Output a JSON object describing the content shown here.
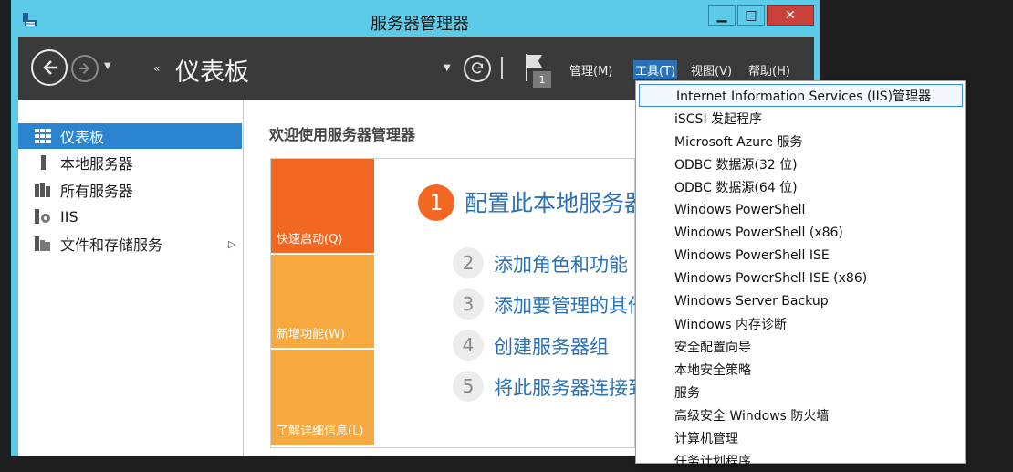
{
  "window": {
    "title": "服务器管理器",
    "minimize": "▁",
    "maximize": "□",
    "close": "✕"
  },
  "cmdbar": {
    "breadcrumb_arrows": "‹‹",
    "title": "仪表板",
    "flag_badge": "1",
    "menus": {
      "manage": "管理(M)",
      "tools": "工具(T)",
      "view": "视图(V)",
      "help": "帮助(H)"
    }
  },
  "sidebar": {
    "items": [
      {
        "label": "仪表板",
        "icon": "dashboard-grid-icon"
      },
      {
        "label": "本地服务器",
        "icon": "local-server-icon"
      },
      {
        "label": "所有服务器",
        "icon": "all-servers-icon"
      },
      {
        "label": "IIS",
        "icon": "iis-icon"
      },
      {
        "label": "文件和存储服务",
        "icon": "file-storage-icon"
      }
    ]
  },
  "main": {
    "welcome": "欢迎使用服务器管理器",
    "tiles": {
      "quick": "快速启动(Q)",
      "new": "新增功能(W)",
      "more": "了解详细信息(L)"
    },
    "steps": [
      {
        "num": "1",
        "text": "配置此本地服务器"
      },
      {
        "num": "2",
        "text": "添加角色和功能"
      },
      {
        "num": "3",
        "text": "添加要管理的其他服务器"
      },
      {
        "num": "4",
        "text": "创建服务器组"
      },
      {
        "num": "5",
        "text": "将此服务器连接到云服务"
      }
    ]
  },
  "tools_menu": {
    "items": [
      "Internet Information Services (IIS)管理器",
      "iSCSI 发起程序",
      "Microsoft Azure 服务",
      "ODBC 数据源(32 位)",
      "ODBC 数据源(64 位)",
      "Windows PowerShell",
      "Windows PowerShell (x86)",
      "Windows PowerShell ISE",
      "Windows PowerShell ISE (x86)",
      "Windows Server Backup",
      "Windows 内存诊断",
      "安全配置向导",
      "本地安全策略",
      "服务",
      "高级安全 Windows 防火墙",
      "计算机管理",
      "任务计划程序"
    ]
  },
  "colors": {
    "accent": "#2b84cf",
    "titlebar": "#5ccbea",
    "orange": "#f26722",
    "tile": "#f7a940"
  }
}
